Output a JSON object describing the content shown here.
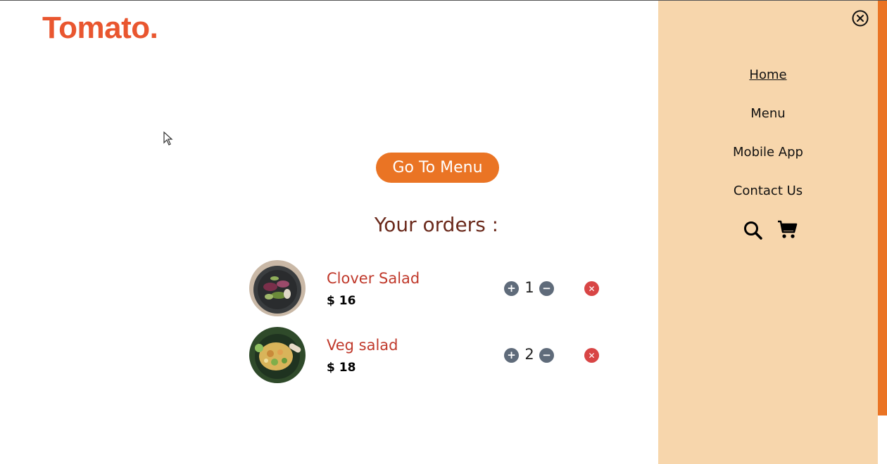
{
  "brand": {
    "logo_text": "Tomato."
  },
  "main": {
    "go_to_menu_label": "Go To Menu",
    "orders_title": "Your orders :"
  },
  "orders": [
    {
      "name": "Clover Salad",
      "price": "$ 16",
      "quantity": "1",
      "image": "clover-salad-photo"
    },
    {
      "name": "Veg salad",
      "price": "$ 18",
      "quantity": "2",
      "image": "veg-salad-photo"
    }
  ],
  "sidebar": {
    "items": [
      {
        "label": "Home",
        "active": true
      },
      {
        "label": "Menu",
        "active": false
      },
      {
        "label": "Mobile App",
        "active": false
      },
      {
        "label": "Contact Us",
        "active": false
      }
    ],
    "icons": [
      "search-icon",
      "cart-icon"
    ],
    "close_icon": "close-circle-icon"
  },
  "colors": {
    "brand": "#e9562f",
    "accent": "#ea7424",
    "sidebar_bg": "#f7d6ac",
    "item_name": "#c0392b",
    "remove": "#d84545",
    "qty_button": "#5f6b7a"
  }
}
